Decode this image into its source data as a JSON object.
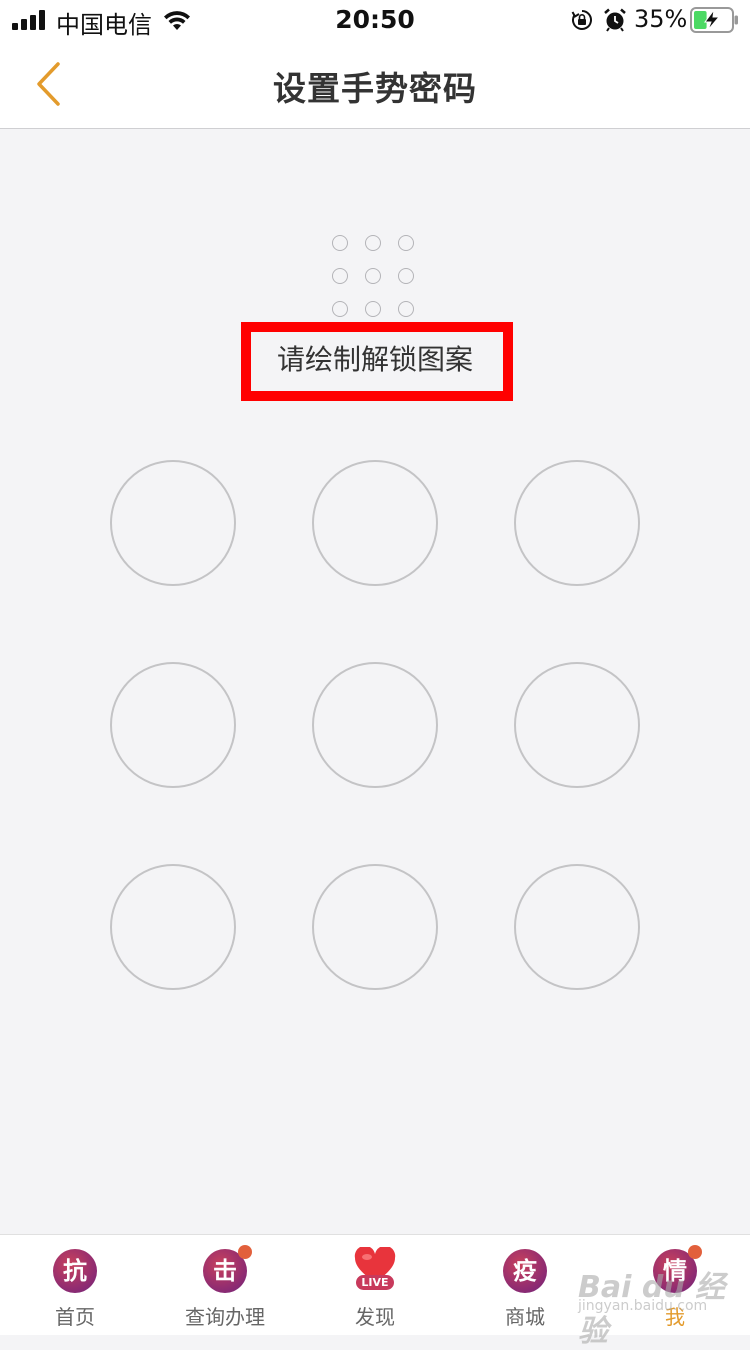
{
  "status_bar": {
    "carrier": "中国电信",
    "time": "20:50",
    "battery_percent": "35%",
    "battery_level": 0.35,
    "icons": [
      "signal-icon",
      "wifi-icon",
      "rotation-lock-icon",
      "alarm-icon",
      "battery-charging-icon"
    ]
  },
  "nav": {
    "title": "设置手势密码",
    "back_icon": "chevron-left-icon"
  },
  "hint": {
    "text": "请绘制解锁图案"
  },
  "pattern": {
    "node_count": 9,
    "preview_dot_count": 9
  },
  "tab_bar": {
    "items": [
      {
        "label": "首页",
        "icon_glyph": "抗",
        "badge": false,
        "active": false
      },
      {
        "label": "查询办理",
        "icon_glyph": "击",
        "badge": true,
        "active": false
      },
      {
        "label": "发现",
        "icon_glyph": "LIVE",
        "badge": false,
        "active": false
      },
      {
        "label": "商城",
        "icon_glyph": "疫",
        "badge": false,
        "active": false
      },
      {
        "label": "我",
        "icon_glyph": "情",
        "badge": true,
        "active": true
      }
    ]
  },
  "watermark": {
    "main": "Bai du 经验",
    "sub": "jingyan.baidu.com"
  },
  "colors": {
    "accent": "#e39b2c",
    "background": "#f4f4f6",
    "highlight": "#ff0000",
    "node_border": "#c4c4c6",
    "badge": "#e2603c"
  }
}
